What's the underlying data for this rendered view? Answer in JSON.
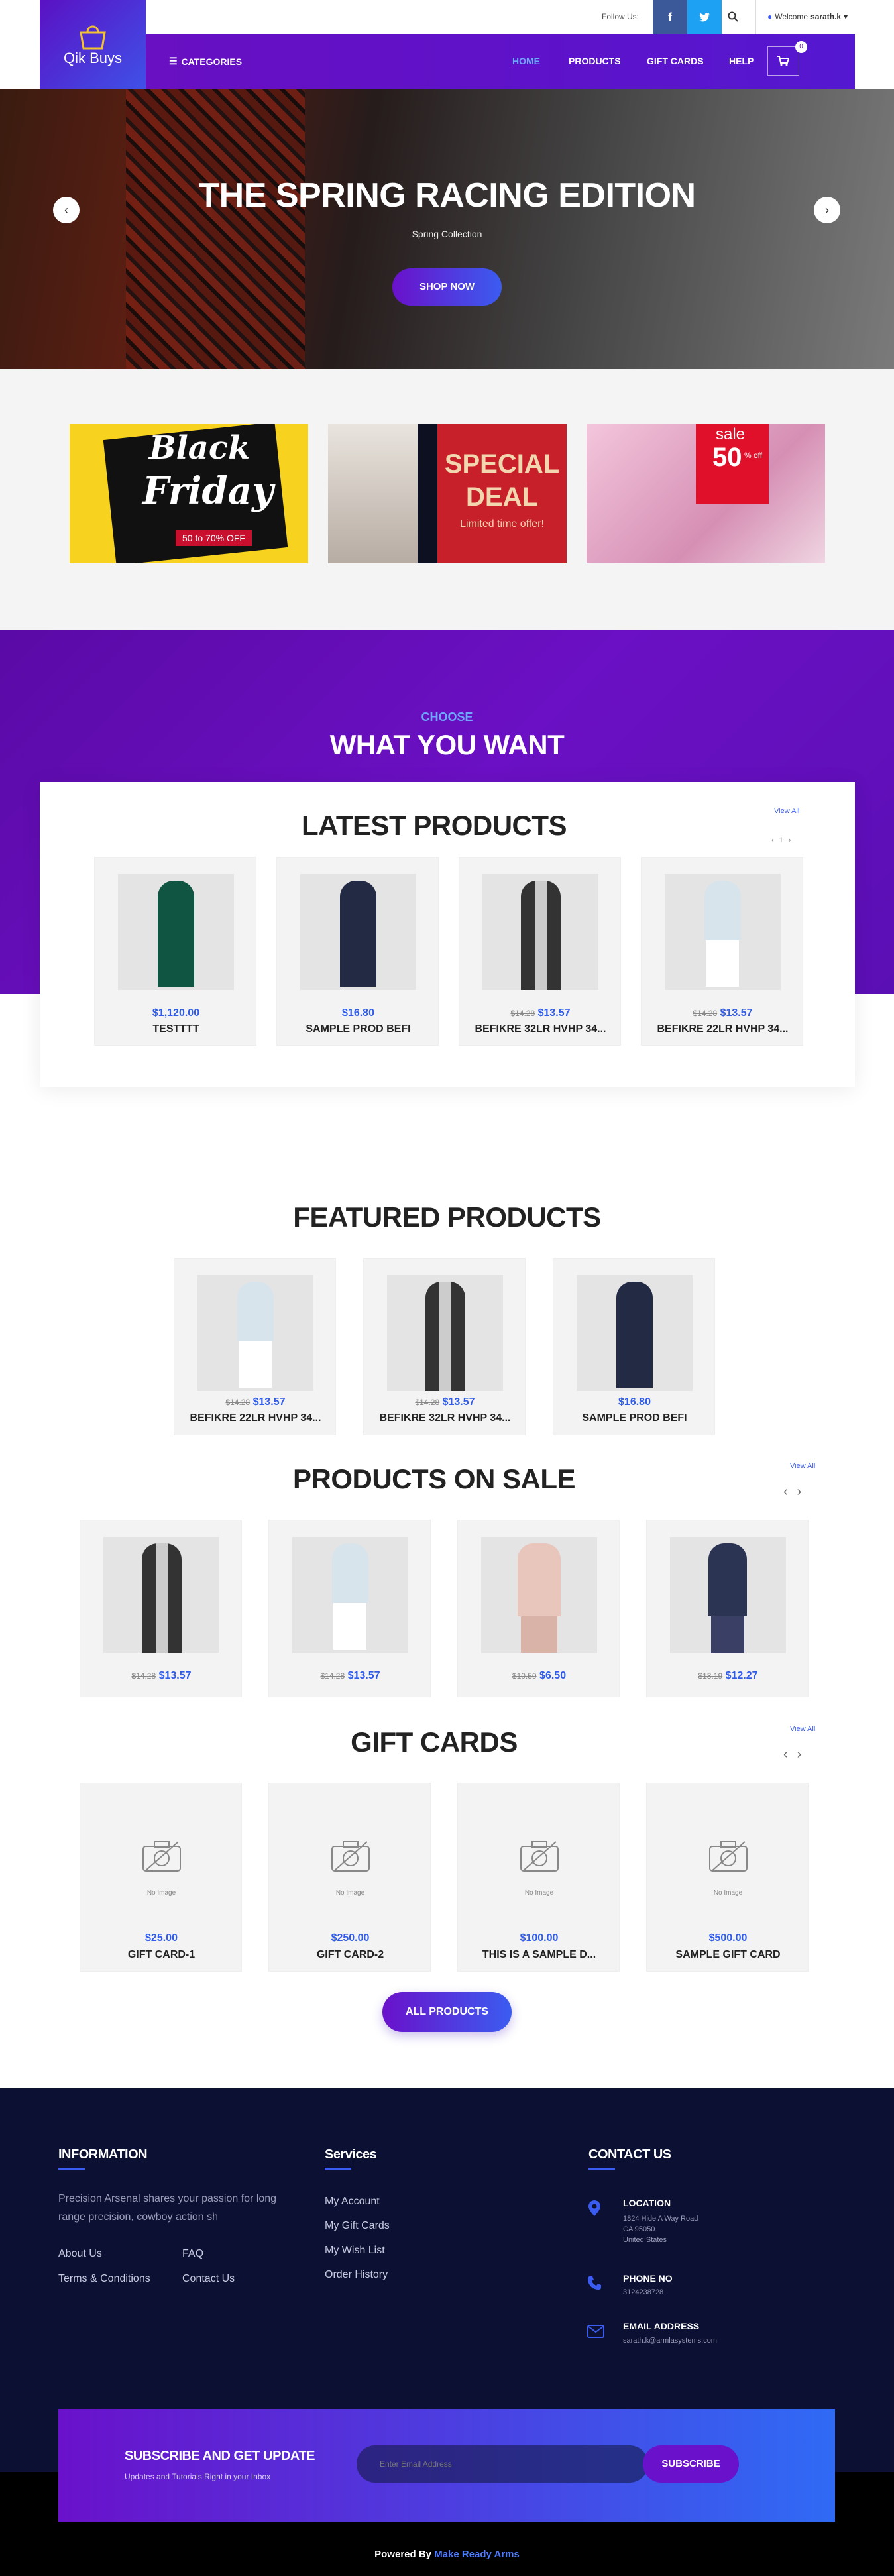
{
  "topbar": {
    "follow_label": "Follow Us:",
    "welcome_prefix": "Welcome",
    "username": "sarath.k"
  },
  "brand": {
    "name": "Qik Buys"
  },
  "nav": {
    "categories": "CATEGORIES",
    "links": [
      "HOME",
      "PRODUCTS",
      "GIFT CARDS",
      "HELP"
    ],
    "cart_count": "0"
  },
  "hero": {
    "title": "THE SPRING RACING EDITION",
    "subtitle": "Spring Collection",
    "cta": "SHOP NOW"
  },
  "banners": [
    {
      "line1": "Black",
      "line2": "Friday",
      "tag": "50 to 70% OFF"
    },
    {
      "line1": "SPECIAL",
      "line2": "DEAL",
      "tag": "Limited time offer!"
    },
    {
      "line1": "sale",
      "line2": "50",
      "tag": "% off"
    }
  ],
  "choose": {
    "eyebrow": "CHOOSE",
    "title": "WHAT YOU WANT"
  },
  "latest": {
    "title": "LATEST PRODUCTS",
    "view_all": "View All",
    "page": "1",
    "items": [
      {
        "name": "TESTTTT",
        "price": "$1,120.00",
        "old": ""
      },
      {
        "name": "SAMPLE PROD BEFI",
        "price": "$16.80",
        "old": ""
      },
      {
        "name": "BEFIKRE 32LR HVHP 34...",
        "price": "$13.57",
        "old": "$14.28"
      },
      {
        "name": "BEFIKRE 22LR HVHP 34...",
        "price": "$13.57",
        "old": "$14.28"
      }
    ]
  },
  "featured": {
    "title": "FEATURED PRODUCTS",
    "items": [
      {
        "name": "BEFIKRE 22LR HVHP 34...",
        "price": "$13.57",
        "old": "$14.28"
      },
      {
        "name": "BEFIKRE 32LR HVHP 34...",
        "price": "$13.57",
        "old": "$14.28"
      },
      {
        "name": "SAMPLE PROD BEFI",
        "price": "$16.80",
        "old": ""
      }
    ]
  },
  "sale": {
    "title": "PRODUCTS ON SALE",
    "view_all": "View All",
    "items": [
      {
        "price": "$13.57",
        "old": "$14.28"
      },
      {
        "price": "$13.57",
        "old": "$14.28"
      },
      {
        "price": "$6.50",
        "old": "$10.50"
      },
      {
        "price": "$12.27",
        "old": "$13.19"
      }
    ]
  },
  "gift": {
    "title": "GIFT CARDS",
    "view_all": "View All",
    "no_image": "No Image",
    "items": [
      {
        "name": "GIFT CARD-1",
        "price": "$25.00"
      },
      {
        "name": "GIFT CARD-2",
        "price": "$250.00"
      },
      {
        "name": "THIS IS A SAMPLE D...",
        "price": "$100.00"
      },
      {
        "name": "SAMPLE GIFT CARD",
        "price": "$500.00"
      }
    ],
    "cta": "ALL PRODUCTS"
  },
  "footer": {
    "info_title": "INFORMATION",
    "info_text": "Precision Arsenal shares your passion for long range precision, cowboy action sh",
    "info_links": [
      "About Us",
      "FAQ",
      "Terms & Conditions",
      "Contact Us"
    ],
    "services_title": "Services",
    "services_links": [
      "My Account",
      "My Gift Cards",
      "My Wish List",
      "Order History"
    ],
    "contact_title": "CONTACT US",
    "location_label": "LOCATION",
    "location_lines": [
      "1824 Hide A Way Road",
      "CA 95050",
      "United States"
    ],
    "phone_label": "PHONE NO",
    "phone": "3124238728",
    "email_label": "EMAIL ADDRESS",
    "email": "sarath.k@armlasystems.com"
  },
  "subscribe": {
    "title": "SUBSCRIBE AND GET UPDATE",
    "subtitle": "Updates and Tutorials Right in your Inbox",
    "placeholder": "Enter Email Address",
    "button": "SUBSCRIBE"
  },
  "powered": {
    "prefix": "Powered By",
    "brand": "Make Ready Arms"
  },
  "colors": {
    "primary": "#6a11cb",
    "accent": "#3b5cf0",
    "footer": "#0c1033"
  }
}
